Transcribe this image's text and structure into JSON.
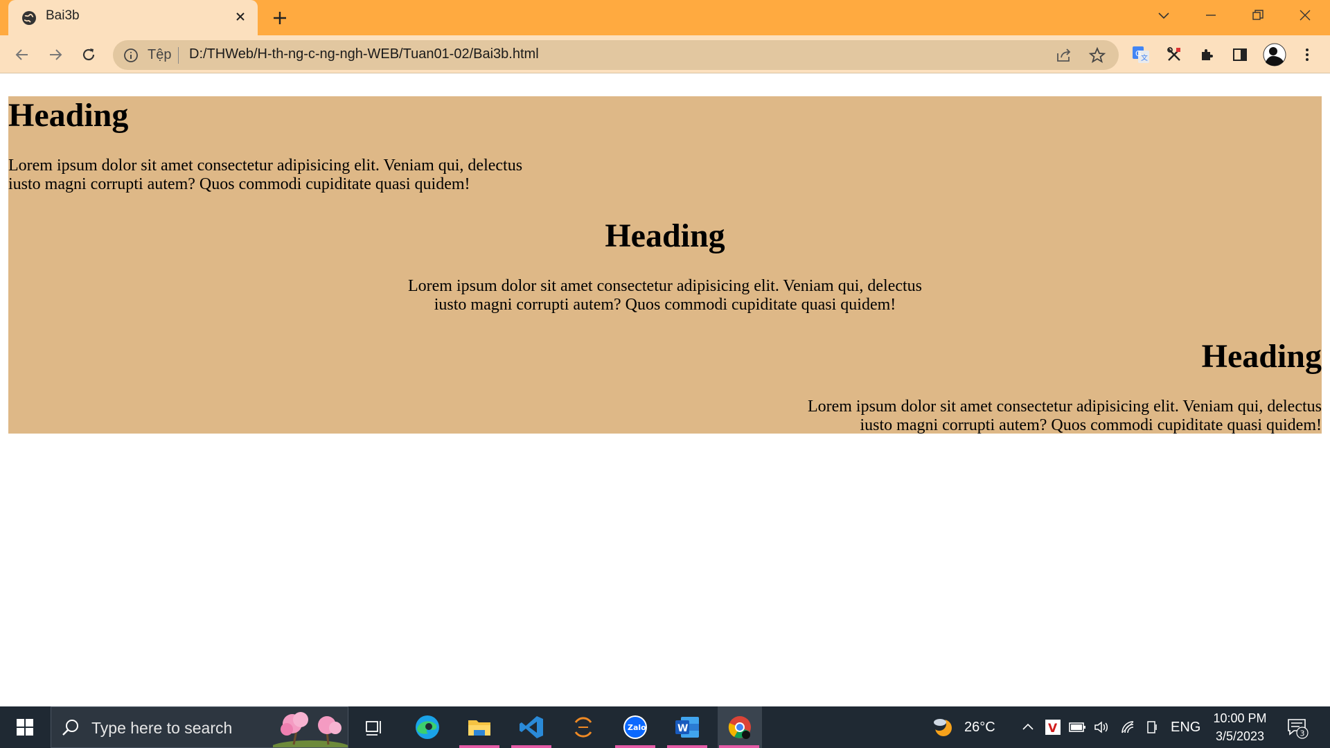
{
  "browser": {
    "tab_title": "Bai3b",
    "omnibox_scheme": "Tệp",
    "url": "D:/THWeb/H-th-ng-c-ng-ngh-WEB/Tuan01-02/Bai3b.html",
    "frame_color": "#FFAA40",
    "toolbar_color": "#FCE0BE"
  },
  "page": {
    "background": "#DEB887",
    "blocks": [
      {
        "heading": "Heading",
        "paragraph": "Lorem ipsum dolor sit amet consectetur adipisicing elit. Veniam qui, delectus iusto magni corrupti autem? Quos commodi cupiditate quasi quidem!",
        "align": "left"
      },
      {
        "heading": "Heading",
        "paragraph": "Lorem ipsum dolor sit amet consectetur adipisicing elit. Veniam qui, delectus iusto magni corrupti autem? Quos commodi cupiditate quasi quidem!",
        "align": "center"
      },
      {
        "heading": "Heading",
        "paragraph": "Lorem ipsum dolor sit amet consectetur adipisicing elit. Veniam qui, delectus iusto magni corrupti autem? Quos commodi cupiditate quasi quidem!",
        "align": "right"
      }
    ]
  },
  "taskbar": {
    "search_placeholder": "Type here to search",
    "apps": [
      "task-view",
      "edge",
      "file-explorer",
      "vscode",
      "eclipse",
      "zalo",
      "word",
      "chrome"
    ],
    "weather": "26°C",
    "language": "ENG",
    "time": "10:00 PM",
    "date": "3/5/2023",
    "notification_count": "3"
  }
}
